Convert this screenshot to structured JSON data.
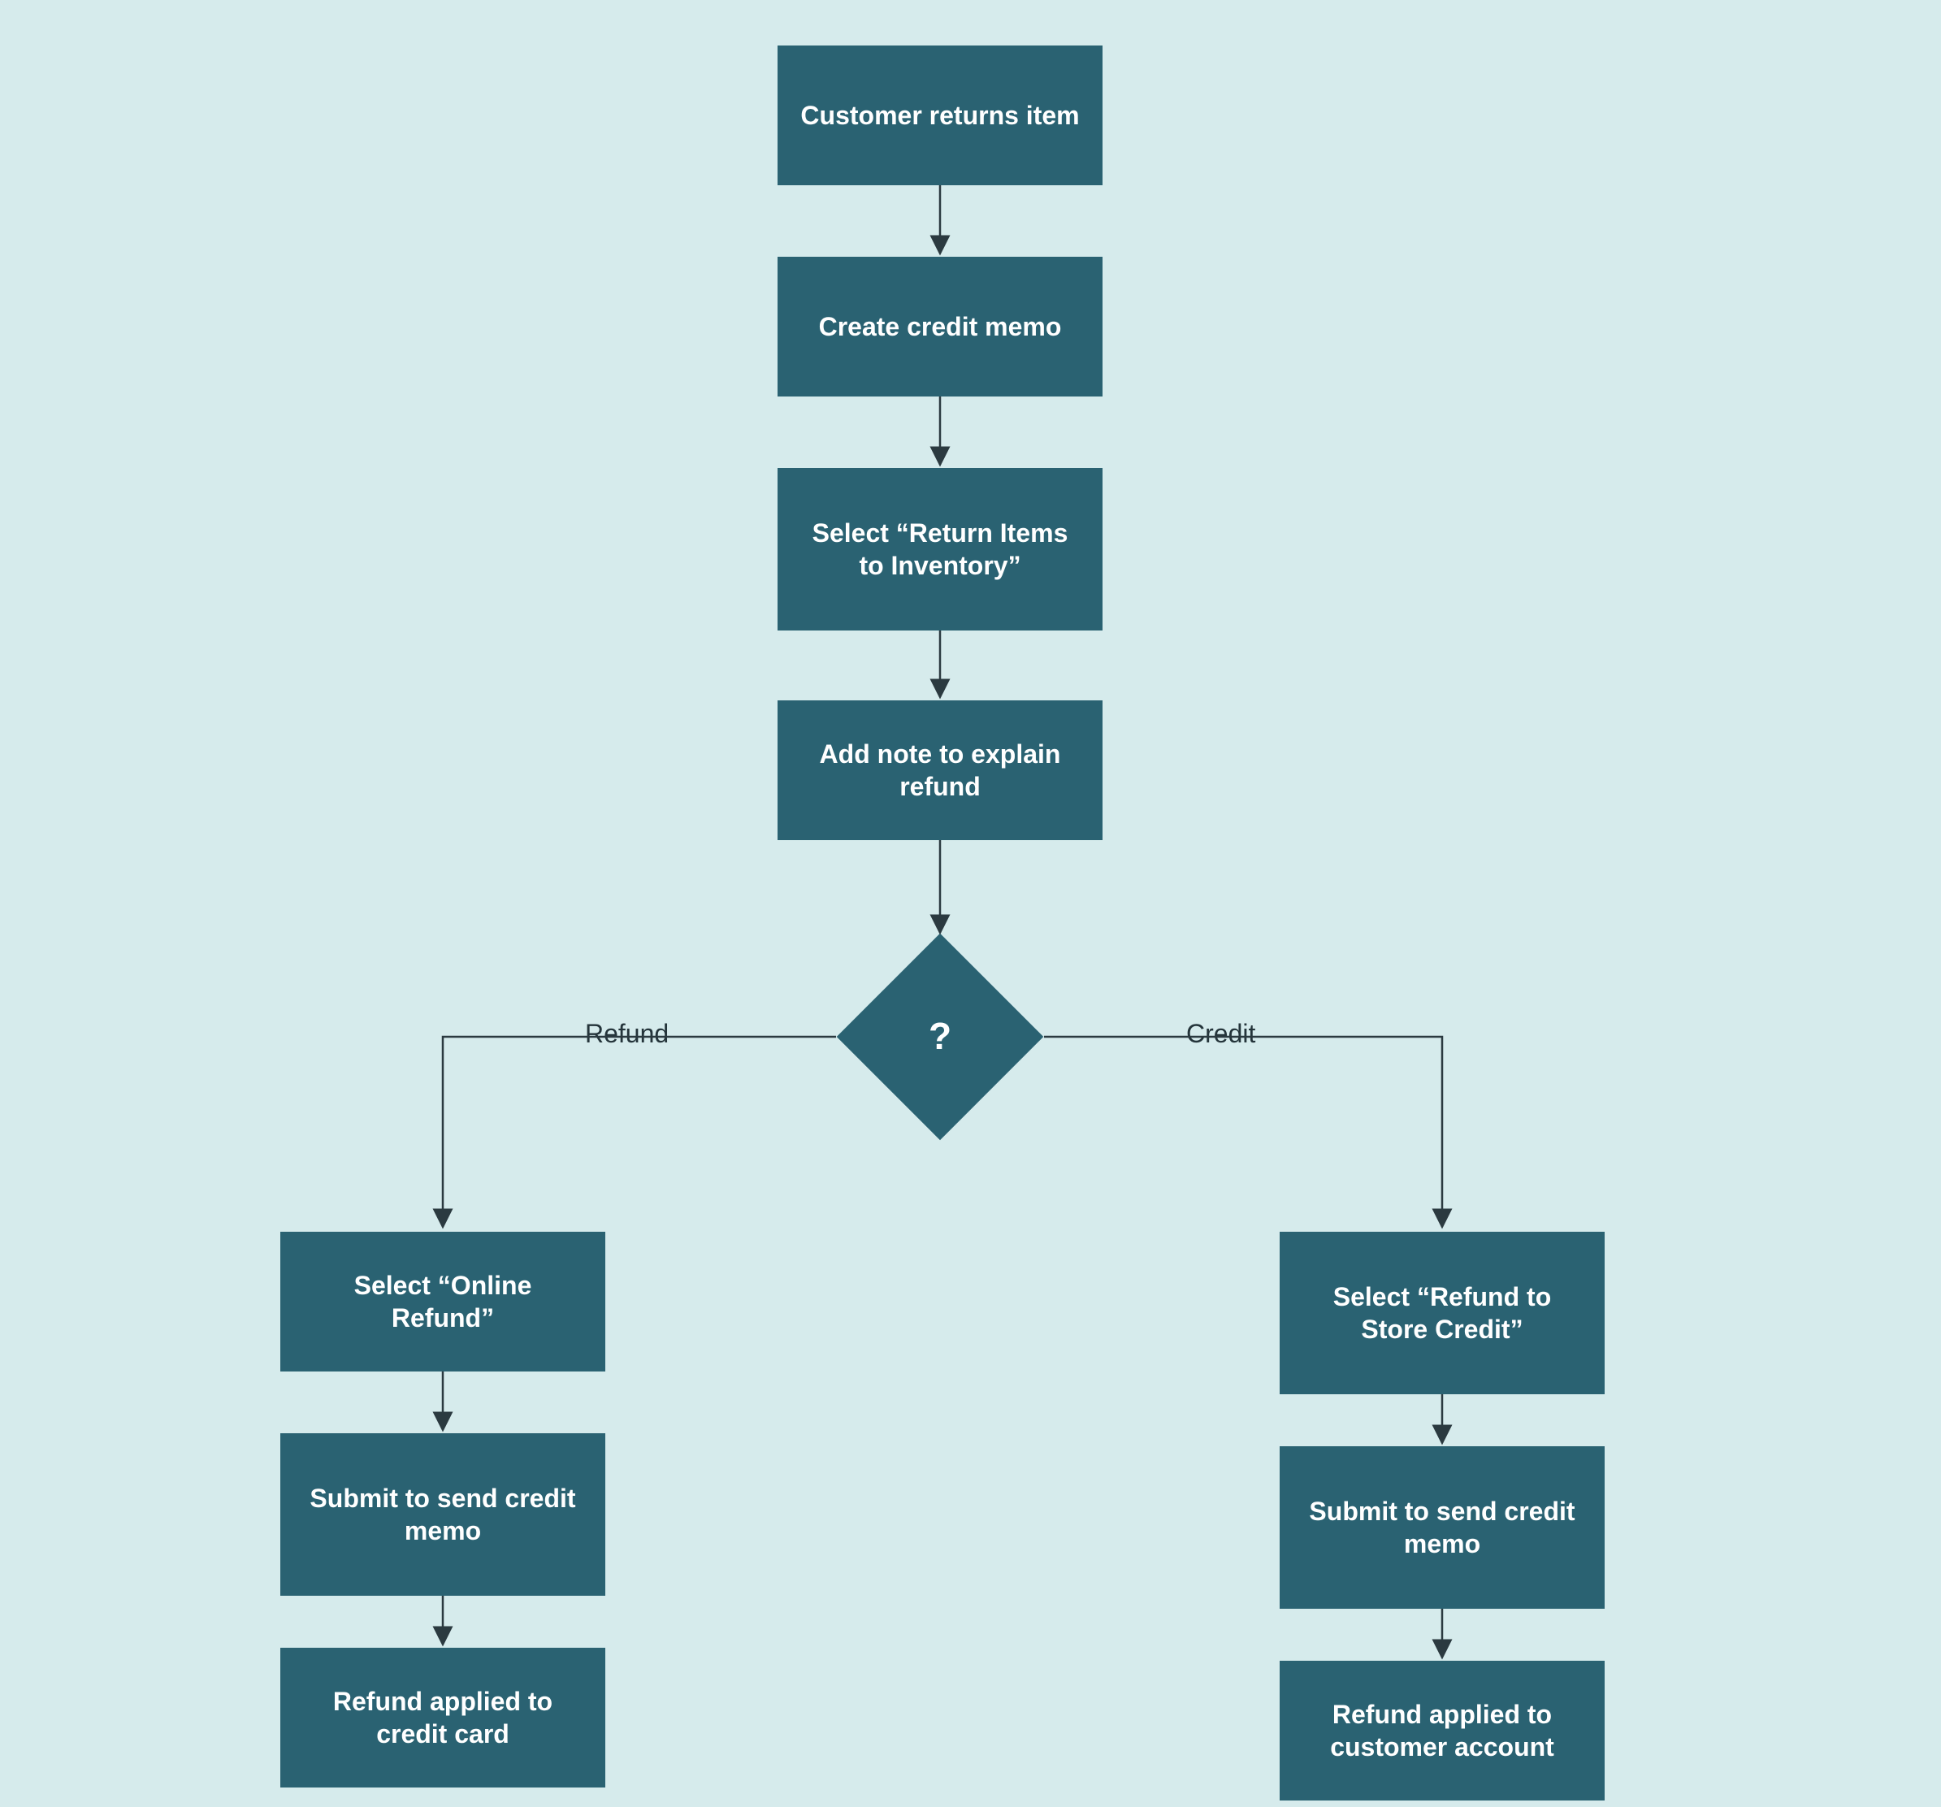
{
  "nodes": {
    "n1": "Customer returns item",
    "n2": "Create credit memo",
    "n3": "Select “Return Items to Inventory”",
    "n4": "Add note to explain refund",
    "decision": "?",
    "left1": "Select “Online Refund”",
    "left2": "Submit to send credit memo",
    "left3": "Refund applied to credit card",
    "right1": "Select “Refund to Store Credit”",
    "right2": "Submit to send credit memo",
    "right3": "Refund applied to customer account"
  },
  "branches": {
    "left": "Refund",
    "right": "Credit"
  },
  "colors": {
    "background": "#d6ebec",
    "node_fill": "#2a6272",
    "node_text": "#ffffff",
    "connector": "#2b3a40"
  },
  "diagram": {
    "type": "flowchart",
    "description": "Customer return / refund workflow with decision branch Refund vs Credit"
  }
}
